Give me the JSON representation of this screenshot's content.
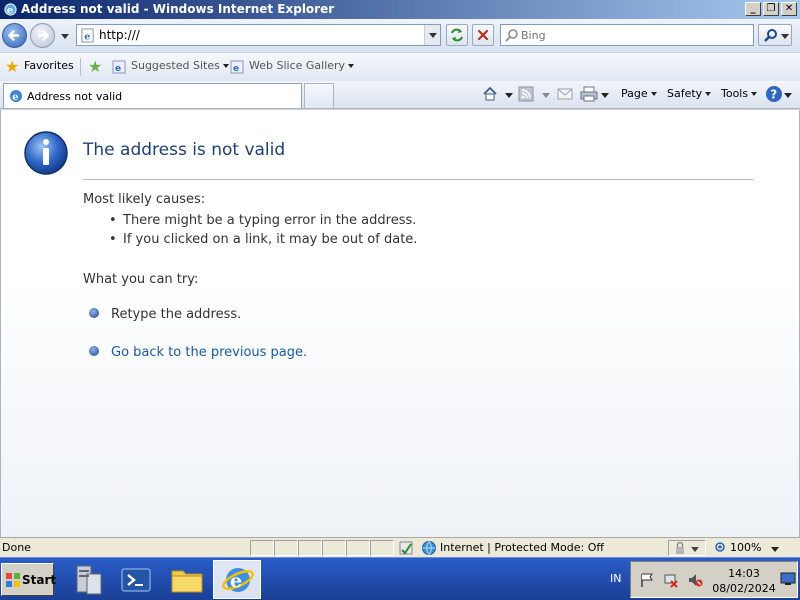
{
  "window": {
    "title": "Address not valid - Windows Internet Explorer",
    "controls": {
      "minimize": "_",
      "restore": "❐",
      "close": "✕"
    }
  },
  "navbar": {
    "address": "http:///",
    "search_placeholder": "Bing"
  },
  "favorites_bar": {
    "favorites_label": "Favorites",
    "items": [
      "Suggested Sites",
      "Web Slice Gallery"
    ]
  },
  "command_bar": {
    "tab_title": "Address not valid",
    "commands": [
      "Page",
      "Safety",
      "Tools"
    ]
  },
  "page": {
    "heading": "The address is not valid",
    "causes_title": "Most likely causes:",
    "causes": [
      "There might be a typing error in the address.",
      "If you clicked on a link, it may be out of date."
    ],
    "try_title": "What you can try:",
    "retype": "Retype the address.",
    "go_back": "Go back to the previous page."
  },
  "statusbar": {
    "status": "Done",
    "zone": "Internet | Protected Mode: Off",
    "zoom": "100%"
  },
  "taskbar": {
    "start_label": "Start",
    "language": "IN",
    "time": "14:03",
    "date": "08/02/2024"
  },
  "colors": {
    "heading": "#1f3f78",
    "link": "#1a5aa8",
    "titlebar_start": "#0a246a"
  }
}
